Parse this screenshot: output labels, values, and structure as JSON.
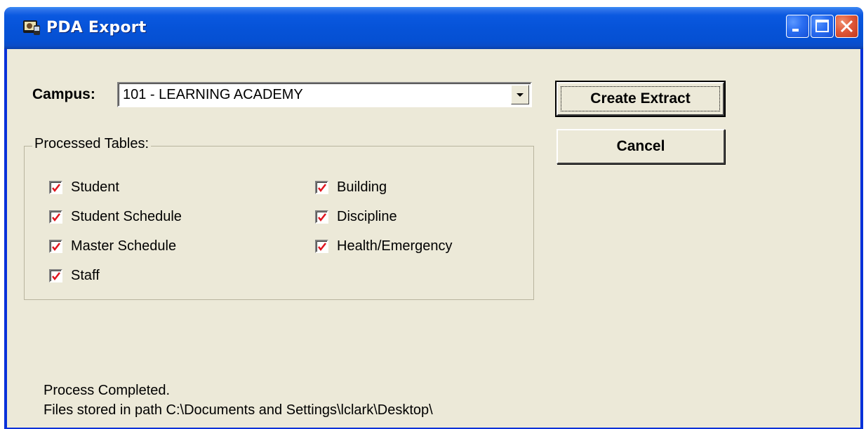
{
  "window": {
    "title": "PDA Export"
  },
  "campus": {
    "label": "Campus:",
    "selected": "101 - LEARNING ACADEMY"
  },
  "buttons": {
    "create_extract": "Create Extract",
    "cancel": "Cancel"
  },
  "processed_tables": {
    "legend": "Processed Tables:",
    "items": [
      {
        "label": "Student",
        "checked": true
      },
      {
        "label": "Student Schedule",
        "checked": true
      },
      {
        "label": "Master Schedule",
        "checked": true
      },
      {
        "label": "Staff",
        "checked": true
      },
      {
        "label": "Building",
        "checked": true
      },
      {
        "label": "Discipline",
        "checked": true
      },
      {
        "label": "Health/Emergency",
        "checked": true
      }
    ]
  },
  "status": {
    "line1": "Process Completed.",
    "line2": "Files stored in path C:\\Documents and Settings\\lclark\\Desktop\\"
  },
  "icons": {
    "app": "app-icon",
    "minimize": "minimize-icon",
    "maximize": "maximize-icon",
    "close": "close-icon",
    "dropdown": "chevron-down-icon",
    "check": "check-icon"
  },
  "colors": {
    "titlebar": "#0653d8",
    "client_bg": "#ece9d8",
    "check_mark": "#e0141e"
  }
}
